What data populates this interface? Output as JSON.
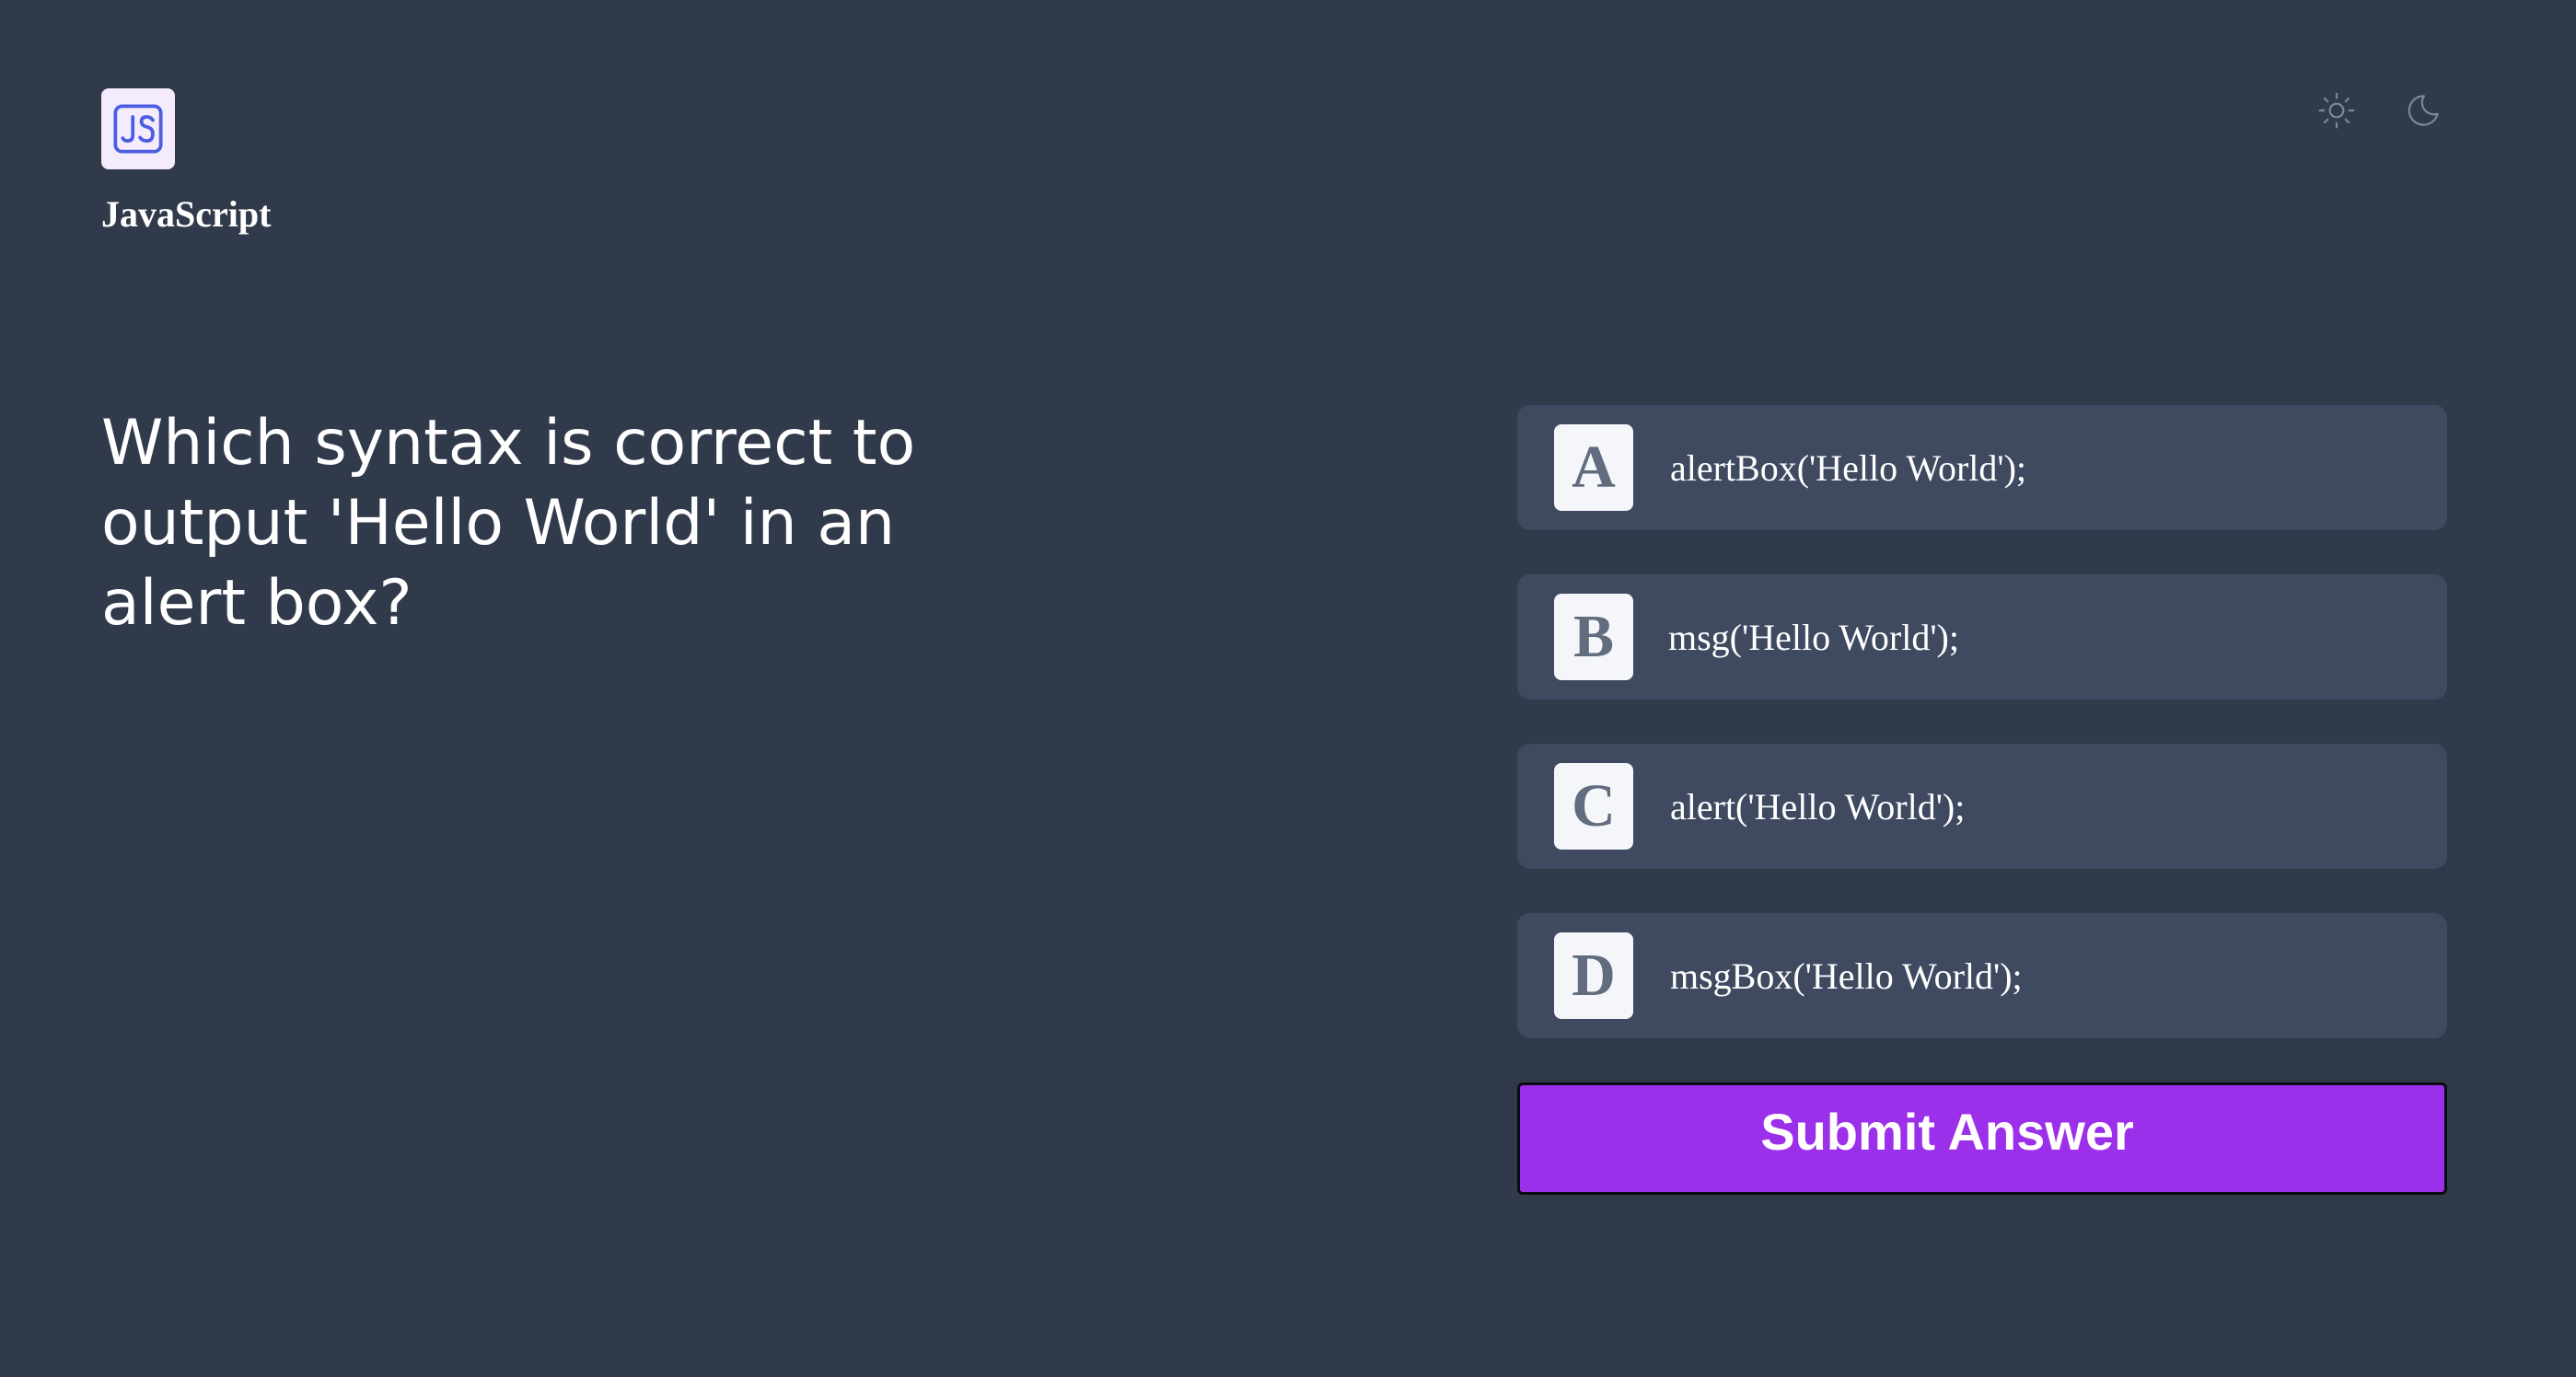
{
  "header": {
    "subject_icon": "js-logo-icon",
    "subject_title": "JavaScript",
    "theme_icons": [
      "sun-icon",
      "moon-icon"
    ]
  },
  "quiz": {
    "question": "Which syntax is correct to output 'Hello World' in an alert box?",
    "options": [
      {
        "letter": "A",
        "text": "alertBox('Hello World');"
      },
      {
        "letter": "B",
        "text": "msg('Hello World');"
      },
      {
        "letter": "C",
        "text": "alert('Hello World');"
      },
      {
        "letter": "D",
        "text": "msgBox('Hello World');"
      }
    ],
    "submit_label": "Submit Answer"
  },
  "colors": {
    "background": "#313a4a",
    "option_background": "#3f4a61",
    "submit_accent": "#9b2fea",
    "logo_background": "#f4ebfd",
    "logo_accent": "#4c5ee0"
  }
}
